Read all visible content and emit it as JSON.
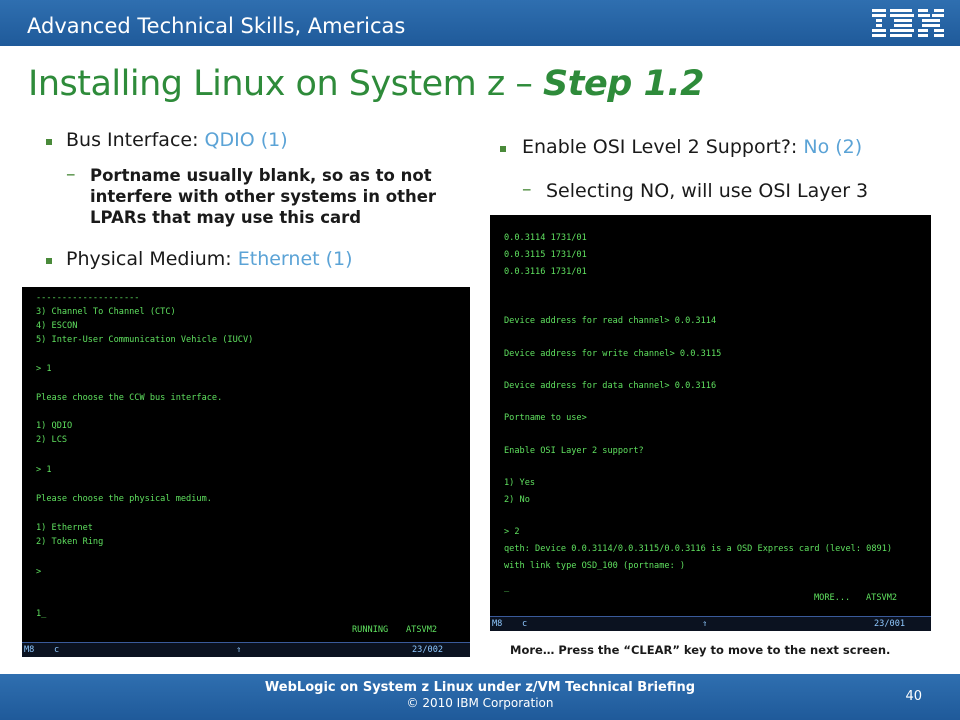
{
  "header": {
    "org": "Advanced Technical Skills, Americas",
    "logo": "ibm-logo-icon"
  },
  "title": {
    "main": "Installing Linux on System z – ",
    "step": "Step 1.2"
  },
  "left": {
    "bullet1_label": "Bus Interface: ",
    "bullet1_value": "QDIO (1)",
    "sub_bold": [
      "Portname usually blank, so as to not",
      "interfere with other systems in other",
      "LPARs that may use this card"
    ],
    "bullet2_label": "Physical Medium: ",
    "bullet2_value": "Ethernet (1)"
  },
  "right": {
    "bullet1_label": "Enable OSI Level 2 Support?: ",
    "bullet1_value": "No (2)",
    "sub": "Selecting NO, will use OSI Layer 3"
  },
  "terminal_left": {
    "lines": [
      "--------------------",
      "3) Channel To Channel (CTC)",
      "4) ESCON",
      "5) Inter-User Communication Vehicle (IUCV)",
      "> 1",
      "Please choose the CCW bus interface.",
      "1) QDIO",
      "2) LCS",
      "> 1",
      "Please choose the physical medium.",
      "1) Ethernet",
      "2) Token Ring",
      ">",
      "1_"
    ],
    "status_running": "RUNNING",
    "status_host": "ATSVM2",
    "bar_left": "M8",
    "bar_c": "c",
    "bar_arrow": "⇑",
    "bar_right": "23/002"
  },
  "terminal_right": {
    "lines": [
      "0.0.3114 1731/01",
      "0.0.3115 1731/01",
      "0.0.3116 1731/01",
      "Device address for read channel> 0.0.3114",
      "Device address for write channel> 0.0.3115",
      "Device address for data channel> 0.0.3116",
      "Portname to use>",
      "Enable OSI Layer 2 support?",
      "1) Yes",
      "2) No",
      "> 2",
      "qeth: Device 0.0.3114/0.0.3115/0.0.3116 is a OSD Express card (level: 0891)",
      "with link type OSD_100 (portname: )",
      "_"
    ],
    "status_more": "MORE...",
    "status_host": "ATSVM2",
    "bar_left": "M8",
    "bar_c": "c",
    "bar_arrow": "⇑",
    "bar_right": "23/001"
  },
  "caption": "More… Press the “CLEAR” key to move to the next screen.",
  "footer": {
    "line1": "WebLogic on System z Linux under z/VM Technical Briefing",
    "line2": "© 2010 IBM Corporation",
    "page": "40"
  }
}
